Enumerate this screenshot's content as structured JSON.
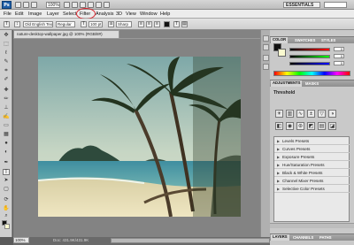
{
  "app": {
    "logo": "Ps",
    "zoom": "100%",
    "workspace": "ESSENTIALS"
  },
  "menu": {
    "items": [
      "File",
      "Edit",
      "Image",
      "Layer",
      "Select",
      "Filter",
      "Analysis",
      "3D",
      "View",
      "Window",
      "Help"
    ]
  },
  "options": {
    "font_family": "Old English Text ...",
    "font_style": "Regular",
    "font_size": "100 pt",
    "antialias": "Sharp"
  },
  "document": {
    "tab_title": "nature-desktop-wallpaper.jpg @ 100% (RGB/8#)",
    "status_zoom": "100%",
    "status_doc": "Doc: 431.9K/431.9K"
  },
  "panels": {
    "color_tabs": [
      "COLOR",
      "SWATCHES",
      "STYLES"
    ],
    "slider_values": [
      "0",
      "0",
      "0"
    ],
    "adj_tabs": [
      "ADJUSTMENTS",
      "MASKS"
    ],
    "adj_title": "Threshold",
    "presets": [
      "Levels Presets",
      "Curves Presets",
      "Exposure Presets",
      "Hue/Saturation Presets",
      "Black & White Presets",
      "Channel Mixer Presets",
      "Selective Color Presets"
    ],
    "layer_tabs": [
      "LAYERS",
      "CHANNELS",
      "PATHS"
    ]
  },
  "colors": {
    "highlight_ring": "#d6242c",
    "foreground": "#111111",
    "background": "#fafad0"
  }
}
